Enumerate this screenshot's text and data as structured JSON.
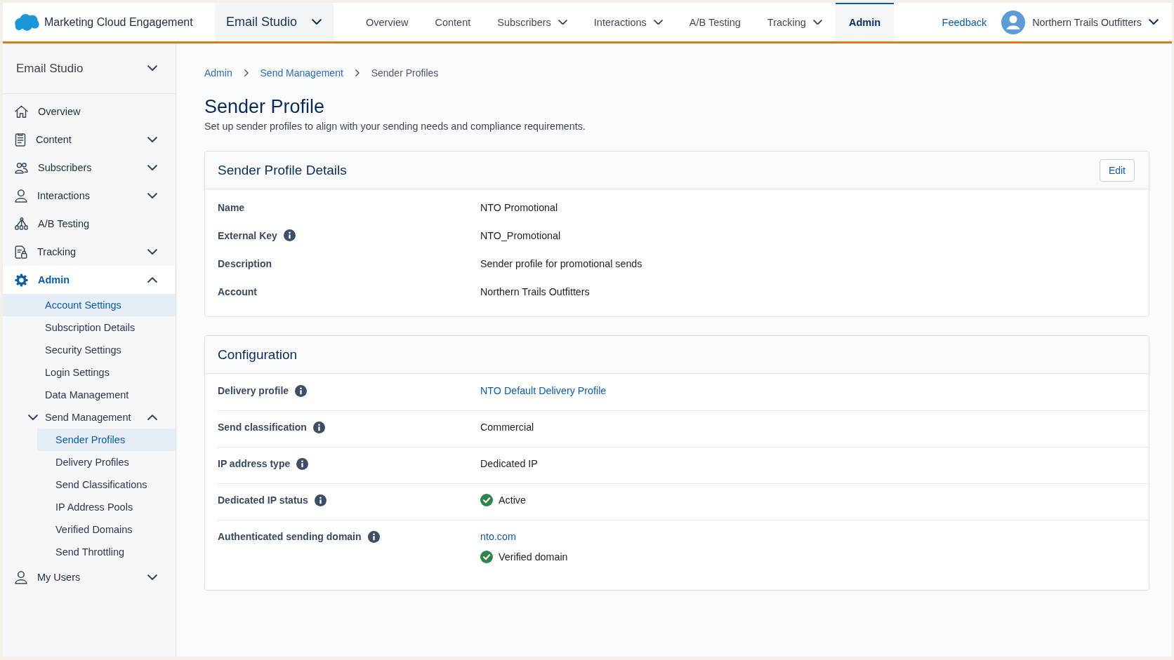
{
  "top_bar": {
    "app_name": "Marketing Cloud Engagement",
    "studio": "Email Studio",
    "nav": [
      {
        "label": "Overview",
        "has_menu": false,
        "selected": false
      },
      {
        "label": "Content",
        "has_menu": false,
        "selected": false
      },
      {
        "label": "Subscribers",
        "has_menu": true,
        "selected": false
      },
      {
        "label": "Interactions",
        "has_menu": true,
        "selected": false
      },
      {
        "label": "A/B Testing",
        "has_menu": false,
        "selected": false
      },
      {
        "label": "Tracking",
        "has_menu": true,
        "selected": false
      },
      {
        "label": "Admin",
        "has_menu": false,
        "selected": true
      }
    ],
    "feedback": "Feedback",
    "account": "Northern Trails Outfitters"
  },
  "sidebar": {
    "header": "Email Studio",
    "items": [
      {
        "label": "Overview",
        "kind": "link",
        "selected": false
      },
      {
        "label": "Content",
        "kind": "group",
        "expanded": false,
        "selected": false
      },
      {
        "label": "Subscribers",
        "kind": "group",
        "expanded": false,
        "selected": false
      },
      {
        "label": "Interactions",
        "kind": "group",
        "expanded": false,
        "selected": false
      },
      {
        "label": "A/B Testing",
        "kind": "link",
        "selected": false
      },
      {
        "label": "Tracking",
        "kind": "group",
        "expanded": false,
        "selected": false
      },
      {
        "label": "Admin",
        "kind": "group",
        "expanded": true,
        "selected": true,
        "children": [
          {
            "label": "Account Settings",
            "kind": "link",
            "selected": true
          },
          {
            "label": "Subscription Details",
            "kind": "link",
            "selected": false
          },
          {
            "label": "Security Settings",
            "kind": "link",
            "selected": false
          },
          {
            "label": "Login Settings",
            "kind": "link",
            "selected": false
          },
          {
            "label": "Data Management",
            "kind": "link",
            "selected": false
          },
          {
            "label": "Send Management",
            "kind": "group",
            "expanded": true,
            "selected": false,
            "children": [
              {
                "label": "Sender Profiles",
                "kind": "link",
                "selected": true
              },
              {
                "label": "Delivery Profiles",
                "kind": "link",
                "selected": false
              },
              {
                "label": "Send Classifications",
                "kind": "link",
                "selected": false
              },
              {
                "label": "IP Address Pools",
                "kind": "link",
                "selected": false
              },
              {
                "label": "Verified Domains",
                "kind": "link",
                "selected": false
              },
              {
                "label": "Send Throttling",
                "kind": "link",
                "selected": false
              }
            ]
          }
        ]
      },
      {
        "label": "My Users",
        "kind": "group",
        "expanded": false,
        "selected": false
      }
    ]
  },
  "breadcrumb": [
    {
      "label": "Admin",
      "kind": "link"
    },
    {
      "label": "Send Management",
      "kind": "link"
    },
    {
      "label": "Sender Profiles",
      "kind": "current"
    }
  ],
  "page": {
    "title": "Sender Profile",
    "subtitle": "Set up sender profiles to align with your sending needs and compliance requirements."
  },
  "details_card": {
    "title": "Sender Profile Details",
    "edit_button": "Edit",
    "fields": [
      {
        "label": "Name",
        "info": false,
        "value": "NTO Promotional"
      },
      {
        "label": "External Key",
        "info": true,
        "value": "NTO_Promotional"
      },
      {
        "label": "Description",
        "info": false,
        "value": "Sender profile for promotional sends"
      },
      {
        "label": "Account",
        "info": false,
        "value": "Northern Trails Outfitters"
      }
    ]
  },
  "configuration_card": {
    "title": "Configuration",
    "fields": [
      {
        "label": "Delivery profile",
        "info": true,
        "values": [
          {
            "kind": "link",
            "text": "NTO Default Delivery Profile"
          }
        ]
      },
      {
        "label": "Send classification",
        "info": true,
        "values": [
          {
            "kind": "text",
            "text": "Commercial"
          }
        ]
      },
      {
        "label": "IP address type",
        "info": true,
        "values": [
          {
            "kind": "text",
            "text": "Dedicated IP"
          }
        ]
      },
      {
        "label": "Dedicated IP status",
        "info": true,
        "values": [
          {
            "kind": "status",
            "text": "Active"
          }
        ]
      },
      {
        "label": "Authenticated sending domain",
        "info": true,
        "values": [
          {
            "kind": "link",
            "text": "nto.com"
          },
          {
            "kind": "status",
            "text": "Verified domain"
          }
        ]
      }
    ]
  }
}
